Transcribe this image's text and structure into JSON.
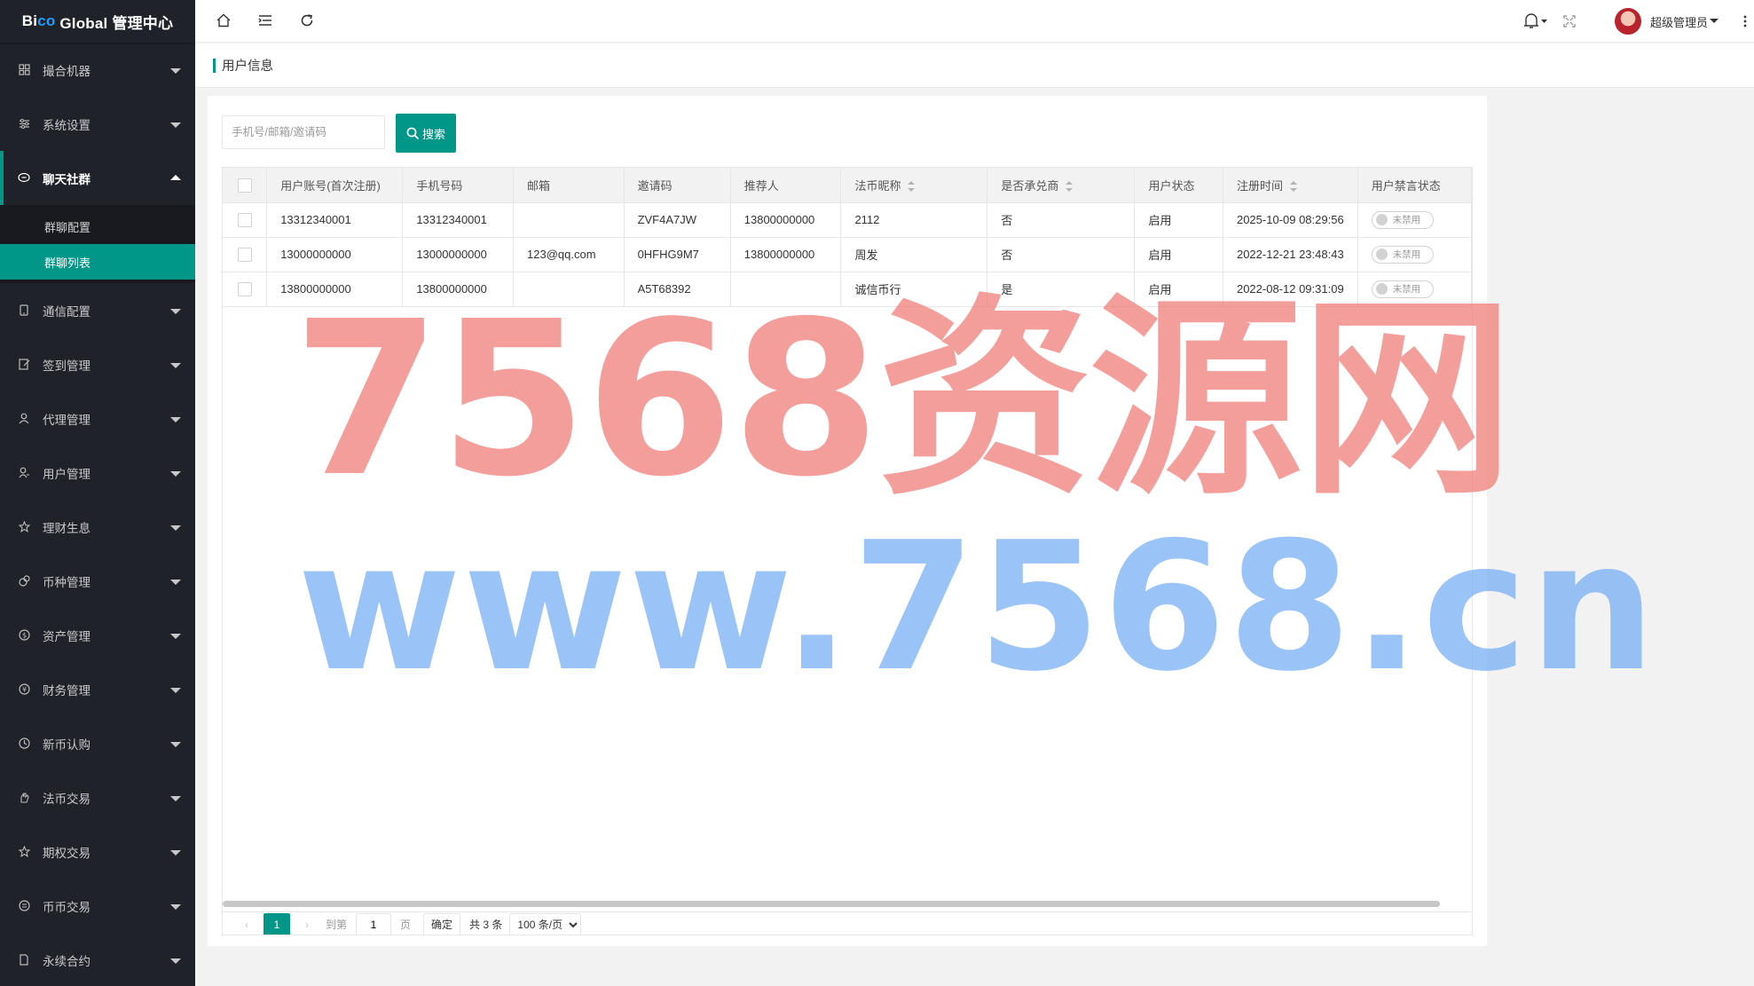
{
  "app": {
    "logo_bi": "Bi",
    "logo_co": "co",
    "logo_rest": " Global 管理中心"
  },
  "sidebar": {
    "items": [
      {
        "label": "撮合机器",
        "icon": "grid-icon"
      },
      {
        "label": "系统设置",
        "icon": "sliders-icon"
      },
      {
        "label": "聊天社群",
        "icon": "chat-icon"
      },
      {
        "label": "通信配置",
        "icon": "phone-icon"
      },
      {
        "label": "签到管理",
        "icon": "checkin-icon"
      },
      {
        "label": "代理管理",
        "icon": "person-icon"
      },
      {
        "label": "用户管理",
        "icon": "users-icon"
      },
      {
        "label": "理财生息",
        "icon": "star-icon"
      },
      {
        "label": "币种管理",
        "icon": "coin-icon"
      },
      {
        "label": "资产管理",
        "icon": "dollar-icon"
      },
      {
        "label": "财务管理",
        "icon": "yen-icon"
      },
      {
        "label": "新币认购",
        "icon": "clock-icon"
      },
      {
        "label": "法币交易",
        "icon": "hand-icon"
      },
      {
        "label": "期权交易",
        "icon": "star-icon"
      },
      {
        "label": "币币交易",
        "icon": "exchange-icon"
      },
      {
        "label": "永续合约",
        "icon": "doc-icon"
      }
    ],
    "submenu": [
      {
        "label": "群聊配置"
      },
      {
        "label": "群聊列表"
      }
    ]
  },
  "header": {
    "user_name": "超级管理员"
  },
  "page": {
    "title": "用户信息"
  },
  "search": {
    "placeholder": "手机号/邮箱/邀请码",
    "button_label": "搜索"
  },
  "table": {
    "columns": [
      "用户账号(首次注册)",
      "手机号码",
      "邮箱",
      "邀请码",
      "推荐人",
      "法币昵称",
      "是否承兑商",
      "用户状态",
      "注册时间",
      "用户禁言状态"
    ],
    "rows": [
      [
        "13312340001",
        "13312340001",
        "",
        "ZVF4A7JW",
        "13800000000",
        "2112",
        "否",
        "启用",
        "2025-10-09 08:29:56",
        "未禁用"
      ],
      [
        "13000000000",
        "13000000000",
        "123@qq.com",
        "0HFHG9M7",
        "13800000000",
        "周发",
        "否",
        "启用",
        "2022-12-21 23:48:43",
        "未禁用"
      ],
      [
        "13800000000",
        "13800000000",
        "",
        "A5T68392",
        "",
        "诚信币行",
        "是",
        "启用",
        "2022-08-12 09:31:09",
        "未禁用"
      ]
    ]
  },
  "pager": {
    "current": "1",
    "goto_label": "到第",
    "goto_value": "1",
    "page_unit": "页",
    "confirm_label": "确定",
    "total": "共 3 条",
    "page_size": "100 条/页"
  },
  "watermark": {
    "line1": "7568资源网",
    "line2": "www.7568.cn"
  },
  "colors": {
    "accent": "#009688",
    "sidebar_bg": "#20222a",
    "logo_accent": "#1E9FFF",
    "watermark_red": "#ef7a74",
    "watermark_blue": "#6ba7f5"
  }
}
